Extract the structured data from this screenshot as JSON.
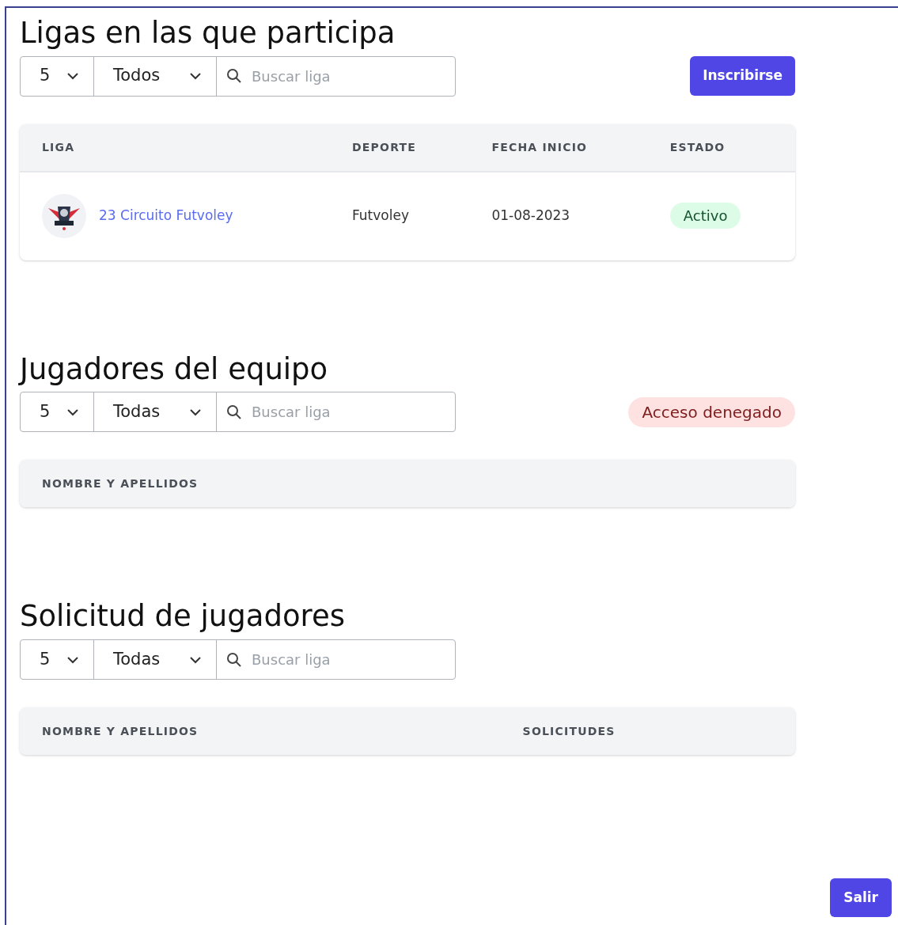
{
  "sections": [
    {
      "title": "Ligas en las que participa",
      "filters": {
        "page_size": "5",
        "status": "Todos",
        "search_placeholder": "Buscar liga"
      },
      "action": {
        "kind": "button",
        "label": "Inscribirse"
      },
      "table": {
        "columns": [
          "LIGA",
          "DEPORTE",
          "FECHA INICIO",
          "ESTADO"
        ],
        "rows": [
          {
            "league": "23 Circuito Futvoley",
            "sport": "Futvoley",
            "start_date": "01-08-2023",
            "status": "Activo"
          }
        ]
      }
    },
    {
      "title": "Jugadores del equipo",
      "filters": {
        "page_size": "5",
        "status": "Todas",
        "search_placeholder": "Buscar liga"
      },
      "action": {
        "kind": "alert",
        "label": "Acceso denegado"
      },
      "table": {
        "columns": [
          "NOMBRE Y APELLIDOS"
        ]
      }
    },
    {
      "title": "Solicitud de jugadores",
      "filters": {
        "page_size": "5",
        "status": "Todas",
        "search_placeholder": "Buscar liga"
      },
      "table": {
        "columns": [
          "NOMBRE Y APELLIDOS",
          "SOLICITUDES"
        ]
      }
    }
  ],
  "exit_button": "Salir"
}
